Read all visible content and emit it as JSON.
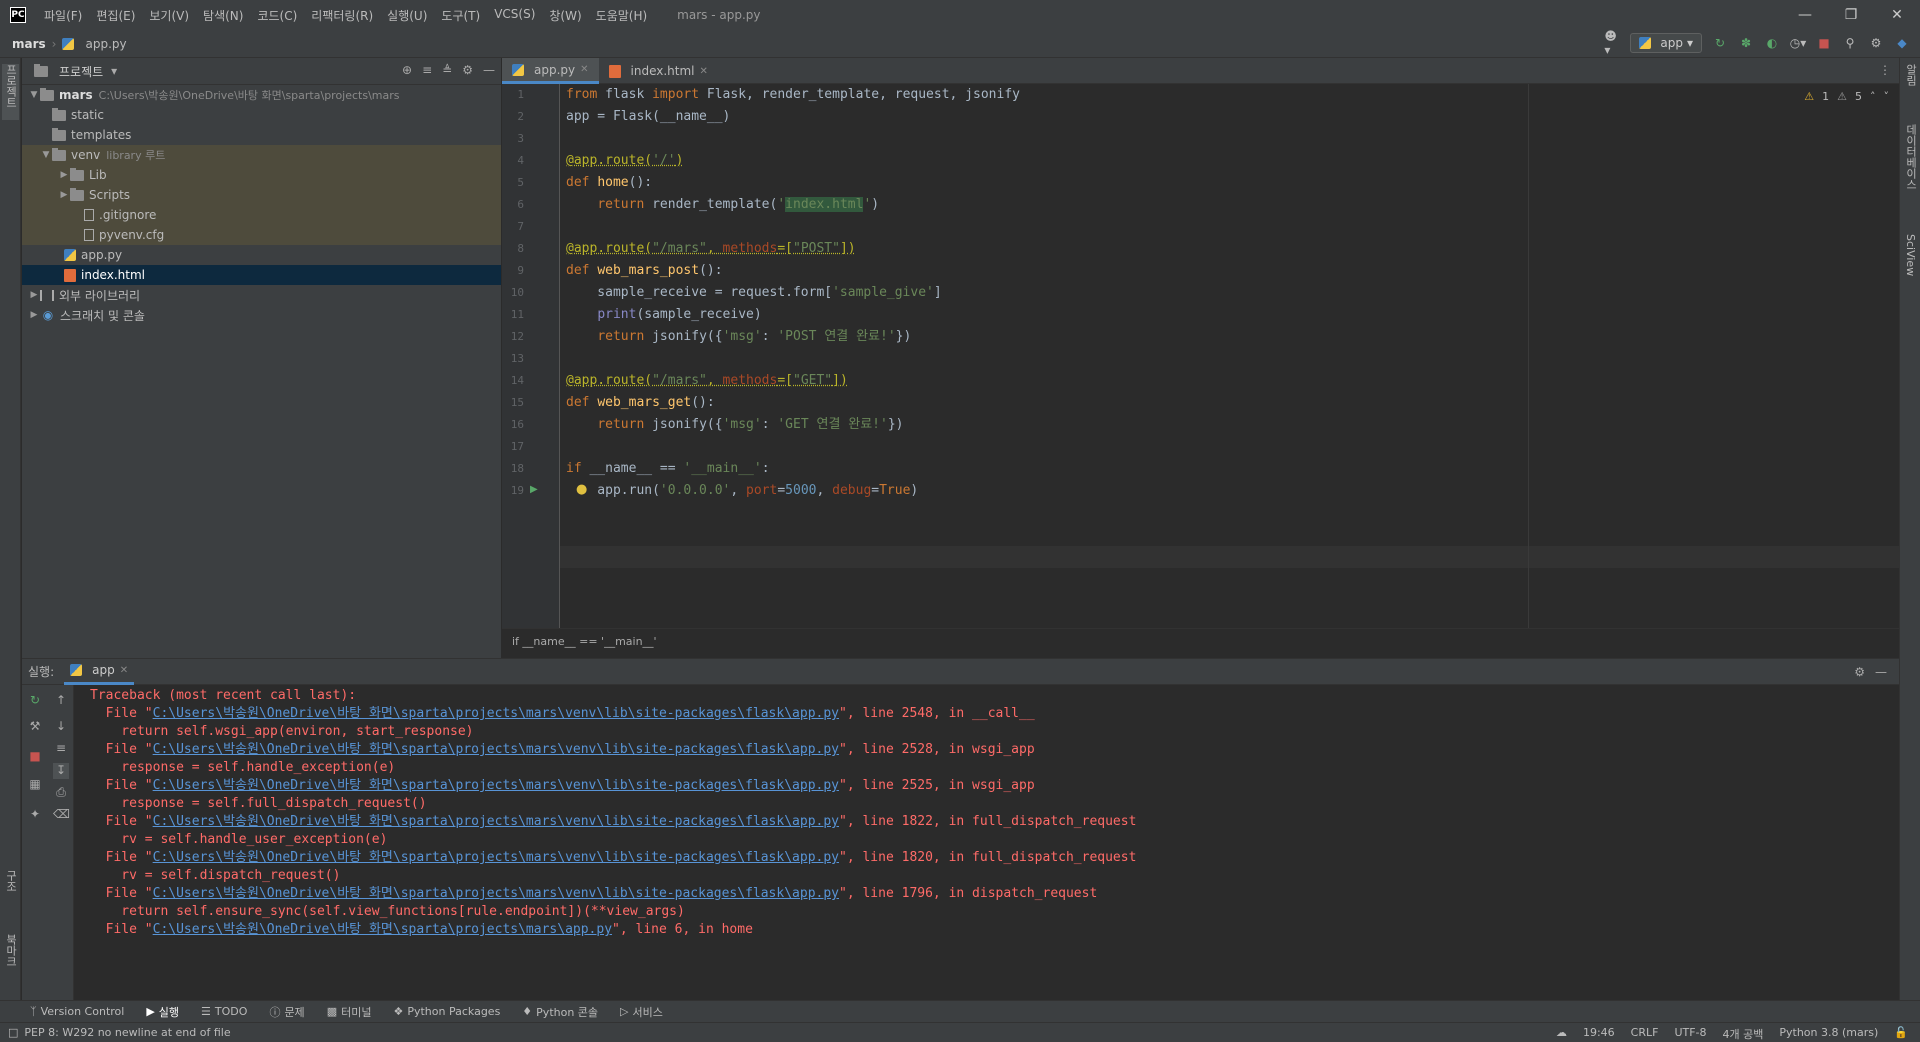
{
  "titlebar": {
    "logo": "PC",
    "menu": [
      "파일(F)",
      "편집(E)",
      "보기(V)",
      "탐색(N)",
      "코드(C)",
      "리팩터링(R)",
      "실행(U)",
      "도구(T)",
      "VCS(S)",
      "창(W)",
      "도움말(H)"
    ],
    "window_title": "mars - app.py"
  },
  "navbar": {
    "project": "mars",
    "file": "app.py",
    "run_config": "app"
  },
  "left_strip": {
    "project_tab": "프로젝트",
    "structure_tab": "구조",
    "bookmarks_tab": "북마크"
  },
  "right_strip": {
    "notifications_tab": "알림",
    "database_tab": "데이터베이스",
    "sciview_tab": "SciView"
  },
  "project_panel": {
    "title": "프로젝트",
    "root": {
      "name": "mars",
      "path": "C:\\Users\\박송원\\OneDrive\\바탕 화면\\sparta\\projects\\mars"
    },
    "items": [
      {
        "name": "static",
        "type": "folder"
      },
      {
        "name": "templates",
        "type": "folder"
      },
      {
        "name": "venv",
        "type": "folder",
        "hint": "library 루트"
      },
      {
        "name": "Lib",
        "type": "folder"
      },
      {
        "name": "Scripts",
        "type": "folder"
      },
      {
        "name": ".gitignore",
        "type": "file"
      },
      {
        "name": "pyvenv.cfg",
        "type": "file"
      },
      {
        "name": "app.py",
        "type": "py"
      },
      {
        "name": "index.html",
        "type": "html"
      }
    ],
    "external_libs": "외부 라이브러리",
    "scratches": "스크래치 및 콘솔"
  },
  "editor": {
    "tabs": [
      {
        "label": "app.py"
      },
      {
        "label": "index.html"
      }
    ],
    "inspections": {
      "warnings": "1",
      "weak_warnings": "5"
    },
    "breadcrumb": "if __name__ == '__main__'",
    "line_numbers": [
      "1",
      "2",
      "3",
      "4",
      "5",
      "6",
      "7",
      "8",
      "9",
      "10",
      "11",
      "12",
      "13",
      "14",
      "15",
      "16",
      "17",
      "18",
      "19"
    ]
  },
  "run_panel": {
    "label": "실행:",
    "tab": "app"
  },
  "console": {
    "header": "Traceback (most recent call last):",
    "file_prefix": "  File \"",
    "lib_path": "C:\\Users\\박송원\\OneDrive\\바탕 화면\\sparta\\projects\\mars\\venv\\lib\\site-packages\\flask\\app.py",
    "app_path": "C:\\Users\\박송원\\OneDrive\\바탕 화면\\sparta\\projects\\mars\\app.py",
    "suffixes": [
      "\", line 2548, in __call__",
      "\", line 2528, in wsgi_app",
      "\", line 2525, in wsgi_app",
      "\", line 1822, in full_dispatch_request",
      "\", line 1820, in full_dispatch_request",
      "\", line 1796, in dispatch_request",
      "\", line 6, in home"
    ],
    "bodies": [
      "    return self.wsgi_app(environ, start_response)",
      "    response = self.handle_exception(e)",
      "    response = self.full_dispatch_request()",
      "    rv = self.handle_user_exception(e)",
      "    rv = self.dispatch_request()",
      "    return self.ensure_sync(self.view_functions[rule.endpoint])(**view_args)"
    ]
  },
  "bottom_tools": [
    "Version Control",
    "실행",
    "TODO",
    "문제",
    "터미널",
    "Python Packages",
    "Python 콘솔",
    "서비스"
  ],
  "statusbar": {
    "message": "PEP 8: W292 no newline at end of file",
    "time": "19:46",
    "line_sep": "CRLF",
    "encoding": "UTF-8",
    "indent": "4개 공백",
    "interpreter": "Python 3.8 (mars)"
  },
  "colors": {
    "accent": "#4a88c7",
    "error_text": "#ff6b68",
    "link": "#5894d6"
  }
}
